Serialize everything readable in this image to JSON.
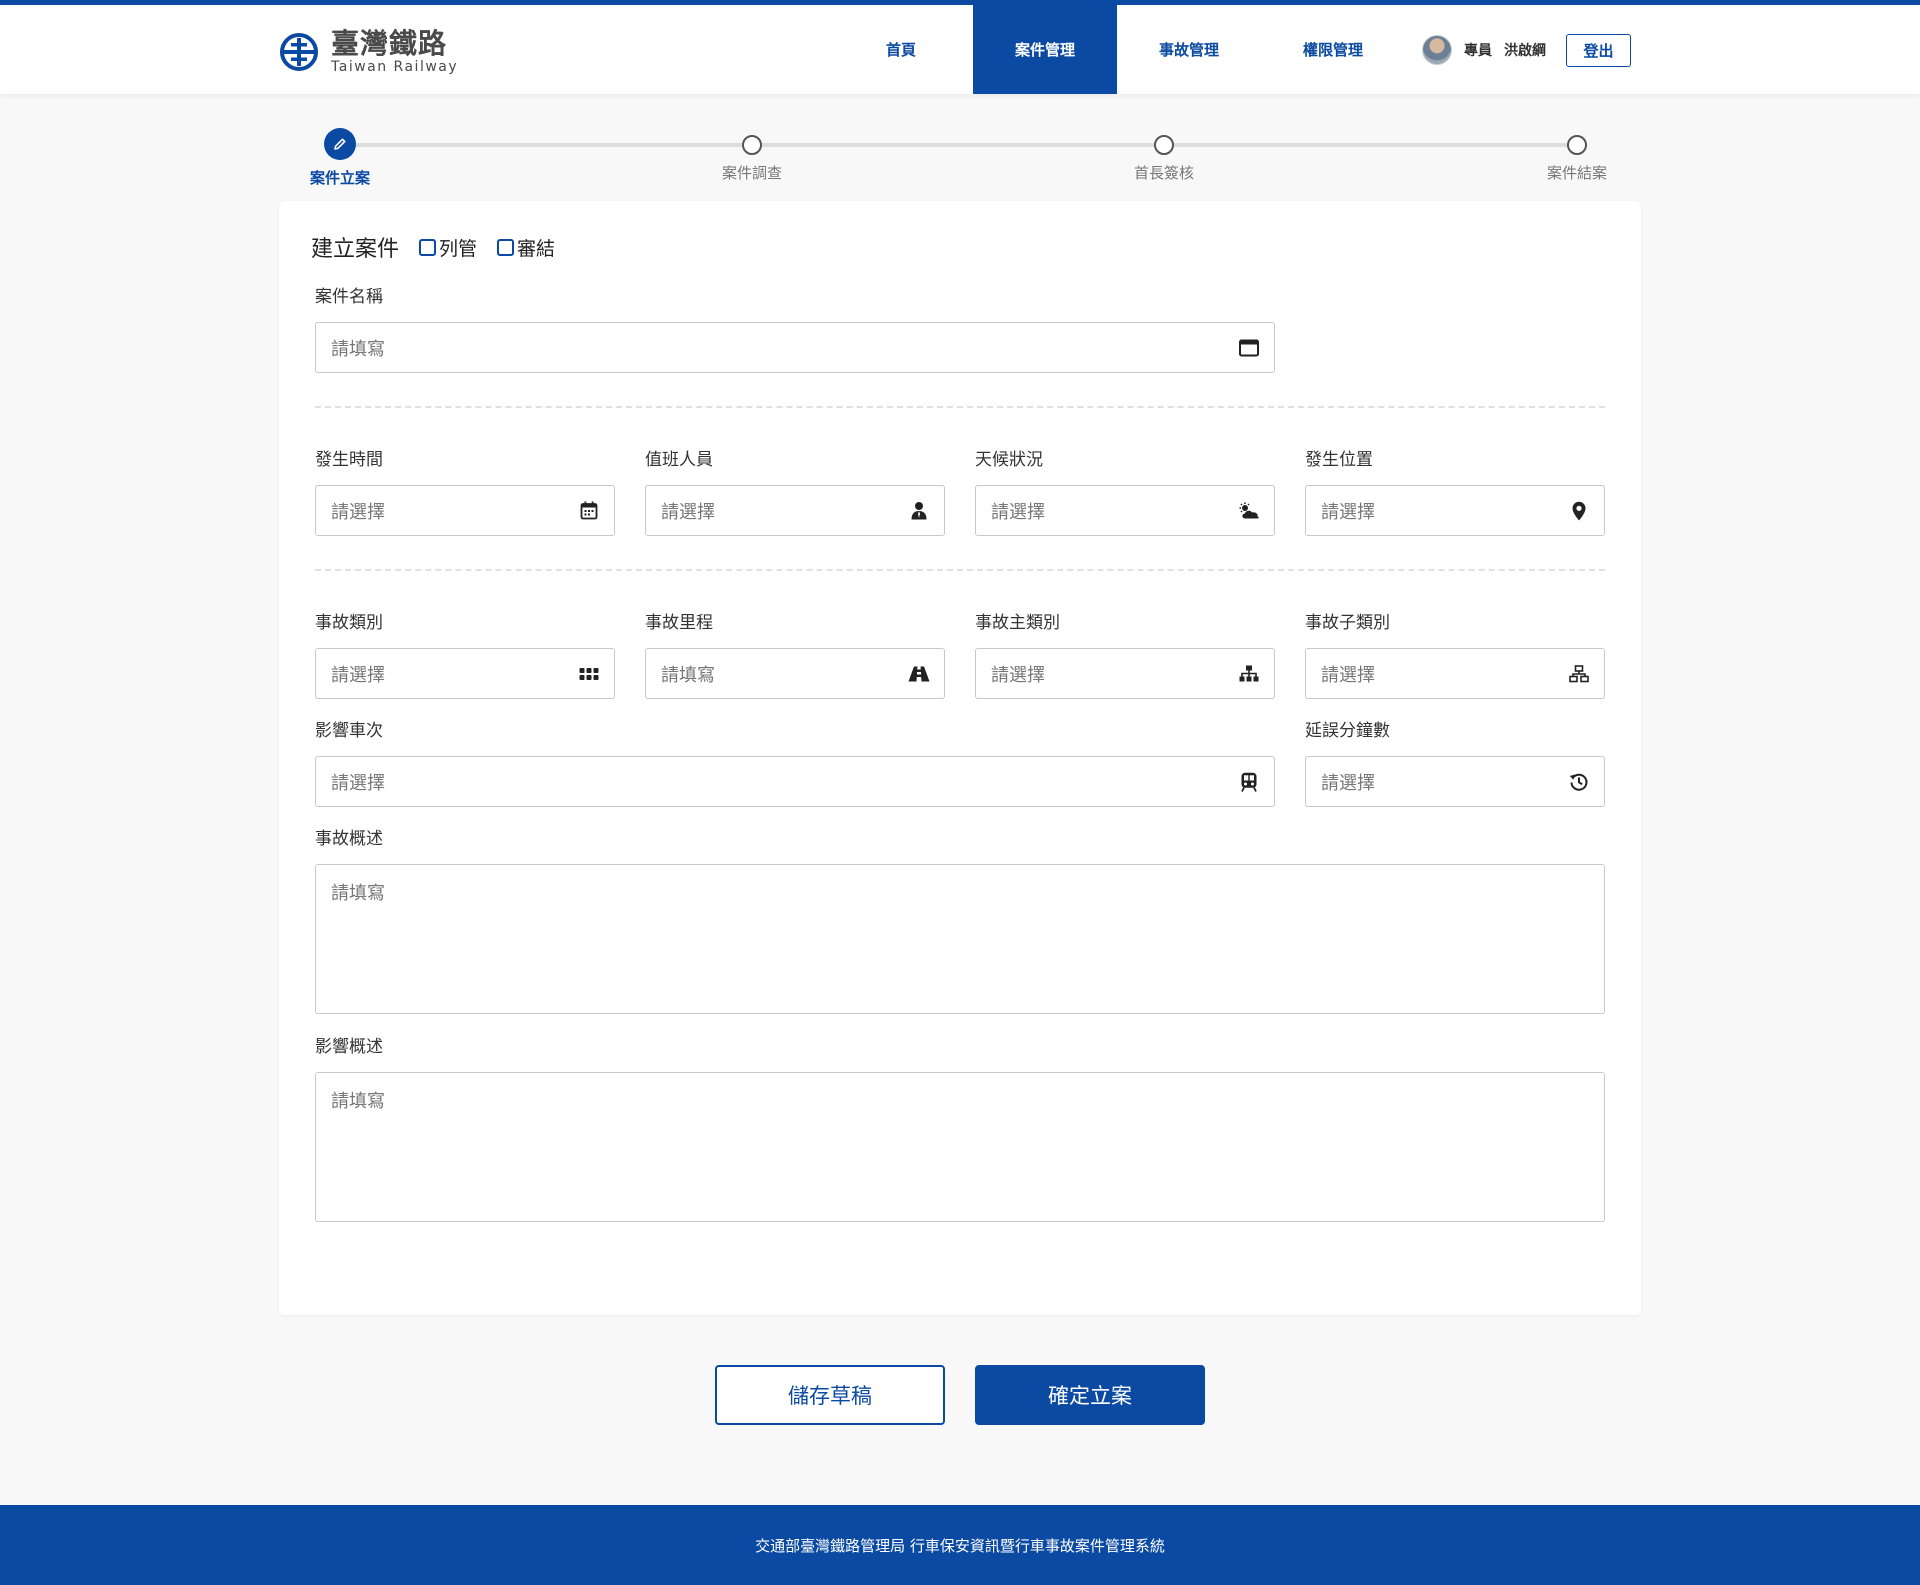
{
  "header": {
    "logo_cn": "臺灣鐵路",
    "logo_en": "Taiwan Railway",
    "nav": [
      {
        "label": "首頁"
      },
      {
        "label": "案件管理"
      },
      {
        "label": "事故管理"
      },
      {
        "label": "權限管理"
      }
    ],
    "active_nav": "案件管理",
    "user_role": "專員",
    "user_name": "洪啟綱",
    "logout_label": "登出"
  },
  "stepper": {
    "steps": [
      {
        "label": "案件立案",
        "state": "active"
      },
      {
        "label": "案件調查",
        "state": "pending"
      },
      {
        "label": "首長簽核",
        "state": "pending"
      },
      {
        "label": "案件結案",
        "state": "pending"
      }
    ]
  },
  "form": {
    "title": "建立案件",
    "checkboxes": [
      {
        "label": "列管",
        "checked": false
      },
      {
        "label": "審結",
        "checked": false
      }
    ],
    "case_name": {
      "label": "案件名稱",
      "placeholder": "請填寫",
      "icon": "window-icon"
    },
    "occur_time": {
      "label": "發生時間",
      "placeholder": "請選擇",
      "icon": "calendar-icon"
    },
    "duty_staff": {
      "label": "值班人員",
      "placeholder": "請選擇",
      "icon": "person-icon"
    },
    "weather": {
      "label": "天候狀況",
      "placeholder": "請選擇",
      "icon": "cloud-sun-icon"
    },
    "location": {
      "label": "發生位置",
      "placeholder": "請選擇",
      "icon": "map-pin-icon"
    },
    "accident_type": {
      "label": "事故類別",
      "placeholder": "請選擇",
      "icon": "grid-icon"
    },
    "accident_mileage": {
      "label": "事故里程",
      "placeholder": "請填寫",
      "icon": "road-icon"
    },
    "accident_main_type": {
      "label": "事故主類別",
      "placeholder": "請選擇",
      "icon": "hierarchy-icon"
    },
    "accident_sub_type": {
      "label": "事故子類別",
      "placeholder": "請選擇",
      "icon": "network-icon"
    },
    "affected_trains": {
      "label": "影響車次",
      "placeholder": "請選擇",
      "icon": "train-icon"
    },
    "delay_minutes": {
      "label": "延誤分鐘數",
      "placeholder": "請選擇",
      "icon": "history-icon"
    },
    "accident_summary": {
      "label": "事故概述",
      "placeholder": "請填寫"
    },
    "impact_summary": {
      "label": "影響概述",
      "placeholder": "請填寫"
    }
  },
  "actions": {
    "save_draft": "儲存草稿",
    "confirm": "確定立案"
  },
  "footer": {
    "text": "交通部臺灣鐵路管理局 行車保安資訊暨行車事故案件管理系統"
  },
  "colors": {
    "primary": "#0b4aa2",
    "background": "#f8f8f8"
  }
}
